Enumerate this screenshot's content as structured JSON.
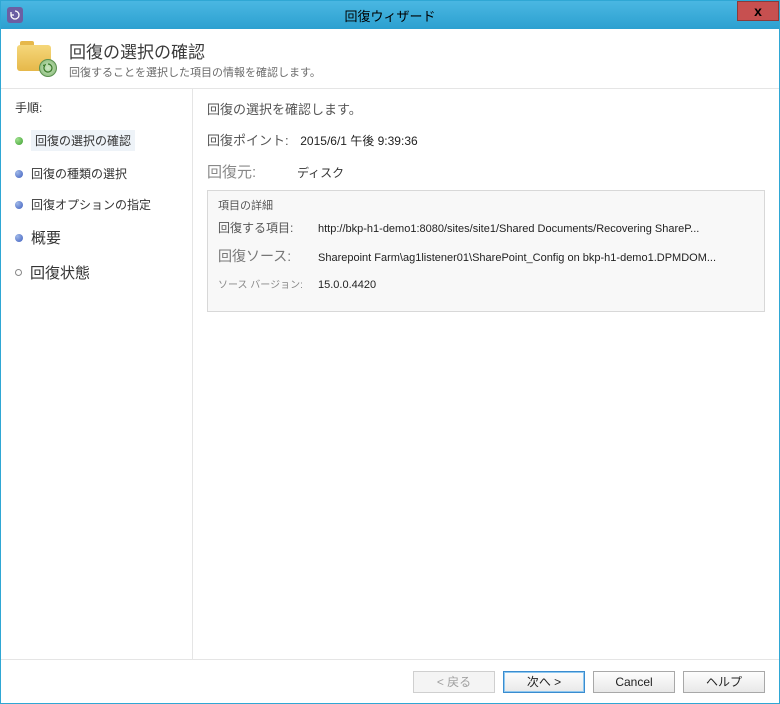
{
  "window": {
    "title": "回復ウィザード",
    "close": "x"
  },
  "header": {
    "title": "回復の選択の確認",
    "subtitle": "回復することを選択した項目の情報を確認します。"
  },
  "sidebar": {
    "steps_label": "手順:",
    "items": [
      {
        "label": "回復の選択の確認"
      },
      {
        "label": "回復の種類の選択"
      },
      {
        "label": "回復オプションの指定"
      },
      {
        "label": "概要"
      },
      {
        "label": "回復状態"
      }
    ]
  },
  "main": {
    "instruction": "回復の選択を確認します。",
    "recovery_point_label": "回復ポイント:",
    "recovery_point_value": "2015/6/1 午後 9:39:36",
    "source_label": "回復元:",
    "source_value": "ディスク",
    "details": {
      "title": "項目の詳細",
      "rows": [
        {
          "label": "回復する項目:",
          "value": "http://bkp-h1-demo1:8080/sites/site1/Shared Documents/Recovering ShareP..."
        },
        {
          "label": "回復ソース:",
          "value": "Sharepoint Farm\\ag1listener01\\SharePoint_Config on bkp-h1-demo1.DPMDOM..."
        },
        {
          "label": "ソース バージョン:",
          "value": "15.0.0.4420"
        }
      ]
    }
  },
  "footer": {
    "back": "< 戻る",
    "next": "次へ >",
    "cancel": "Cancel",
    "help": "ヘルプ"
  }
}
